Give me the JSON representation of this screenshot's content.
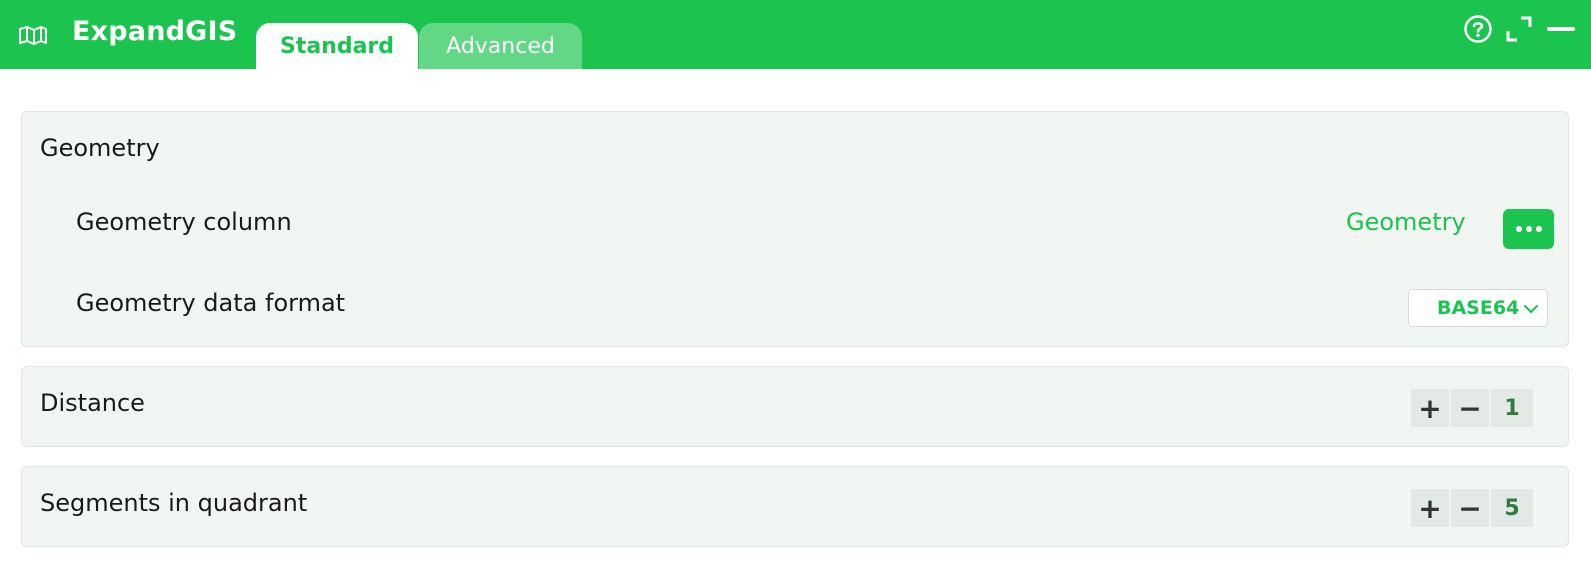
{
  "header": {
    "app_title": "ExpandGIS",
    "tabs": [
      {
        "label": "Standard",
        "active": true
      },
      {
        "label": "Advanced",
        "active": false
      }
    ],
    "icons": [
      "map-icon",
      "help-icon",
      "fullscreen-icon",
      "minimize-icon"
    ]
  },
  "geometry": {
    "title": "Geometry",
    "column_label": "Geometry column",
    "column_value": "Geometry",
    "format_label": "Geometry data format",
    "format_value": "BASE64"
  },
  "distance": {
    "label": "Distance",
    "value": "1",
    "plus": "+",
    "minus": "−"
  },
  "segments": {
    "label": "Segments in quadrant",
    "value": "5",
    "plus": "+",
    "minus": "−"
  },
  "colors": {
    "accent": "#1bc34f",
    "tab_inactive": "#62d785",
    "panel_bg": "#f2f6f3"
  }
}
